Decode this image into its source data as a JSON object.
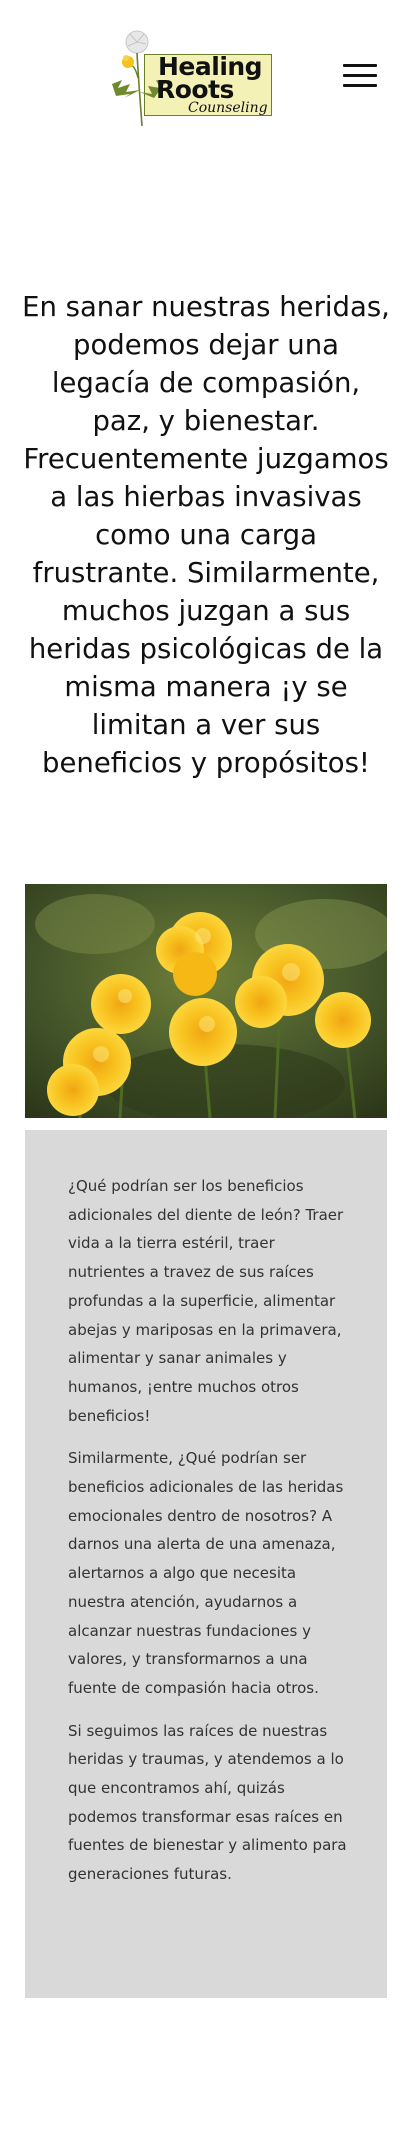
{
  "header": {
    "logo": {
      "line1": "Healing",
      "line2": "Roots",
      "line3": "Counseling"
    },
    "menu_icon": "hamburger-menu-icon"
  },
  "hero": {
    "text": "En sanar nuestras heridas, podemos dejar una legacía de compasión, paz, y bienestar. Frecuentemente juzgamos a las hierbas invasivas como una carga frustrante. Similarmente, muchos juzgan a sus heridas psicológicas de la misma manera ¡y se limitan a ver sus beneficios y propósitos!"
  },
  "photo": {
    "subject": "dandelion-flowers-image"
  },
  "card": {
    "paragraphs": [
      "¿Qué podrían ser los beneficios adicionales del diente de león? Traer vida a la tierra estéril, traer nutrientes a travez de sus raíces profundas a la superficie, alimentar abejas y mariposas en la primavera, alimentar y sanar animales y humanos, ¡entre muchos otros beneficios!",
      "Similarmente, ¿Qué podrían ser beneficios adicionales de las heridas emocionales dentro de nosotros? A darnos una alerta de una amenaza, alertarnos a algo que necesita nuestra atención, ayudarnos a alcanzar nuestras fundaciones y valores, y transformarnos a una fuente de compasión hacia otros.",
      "Si seguimos las raíces de nuestras heridas y traumas, y atendemos a lo que encontramos ahí, quizás podemos transformar esas raíces en fuentes de bienestar y alimento para generaciones futuras."
    ],
    "background": "#d9d9d9"
  },
  "colors": {
    "logo_box": "#f3f1b6",
    "logo_border": "#6b7f2a",
    "flower_yellow": "#f6bd1c",
    "foliage": "#5d6e2c"
  }
}
